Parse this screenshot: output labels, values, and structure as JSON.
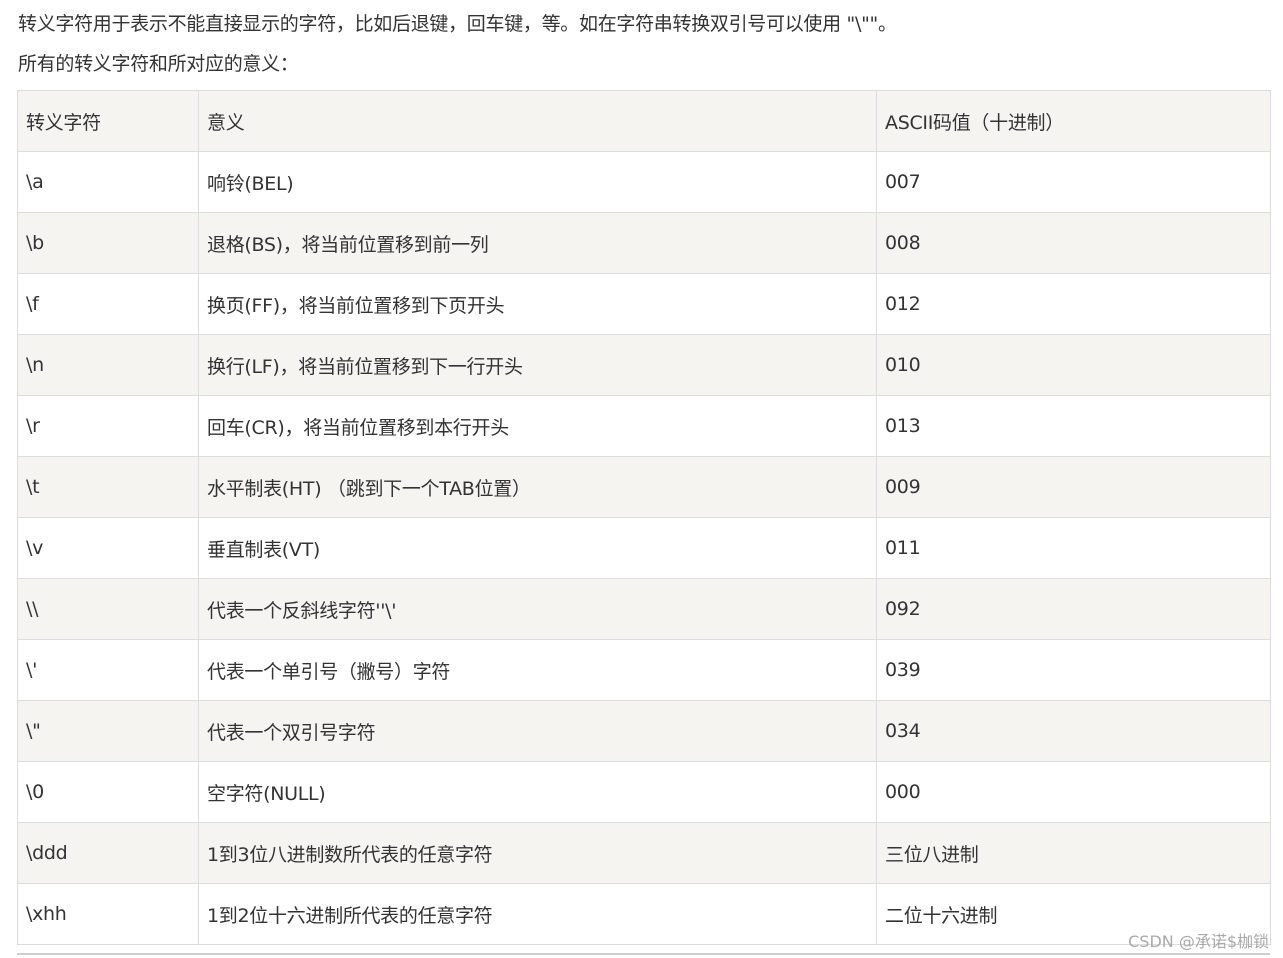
{
  "intro": {
    "line1": "转义字符用于表示不能直接显示的字符，比如后退键，回车键，等。如在字符串转换双引号可以使用 \"\\\"\"。",
    "line2": "所有的转义字符和所对应的意义："
  },
  "table": {
    "headers": [
      "转义字符",
      "意义",
      "ASCII码值（十进制）"
    ],
    "rows": [
      [
        "\\a",
        "响铃(BEL)",
        "007"
      ],
      [
        "\\b",
        "退格(BS)，将当前位置移到前一列",
        "008"
      ],
      [
        "\\f",
        "换页(FF)，将当前位置移到下页开头",
        "012"
      ],
      [
        "\\n",
        "换行(LF)，将当前位置移到下一行开头",
        "010"
      ],
      [
        "\\r",
        "回车(CR)，将当前位置移到本行开头",
        "013"
      ],
      [
        "\\t",
        "水平制表(HT) （跳到下一个TAB位置）",
        "009"
      ],
      [
        "\\v",
        "垂直制表(VT)",
        "011"
      ],
      [
        "\\\\",
        "代表一个反斜线字符''\\'",
        "092"
      ],
      [
        "\\'",
        "代表一个单引号（撇号）字符",
        "039"
      ],
      [
        "\\\"",
        "代表一个双引号字符",
        "034"
      ],
      [
        "\\0",
        "空字符(NULL)",
        "000"
      ],
      [
        "\\ddd",
        "1到3位八进制数所代表的任意字符",
        "三位八进制"
      ],
      [
        "\\xhh",
        "1到2位十六进制所代表的任意字符",
        "二位十六进制"
      ]
    ]
  },
  "watermark": "CSDN @承诺$枷锁",
  "colors": {
    "header_bg": "#f5f4f0",
    "stripe_bg": "#f5f4f0",
    "border": "#dddddd",
    "text": "#333333"
  }
}
